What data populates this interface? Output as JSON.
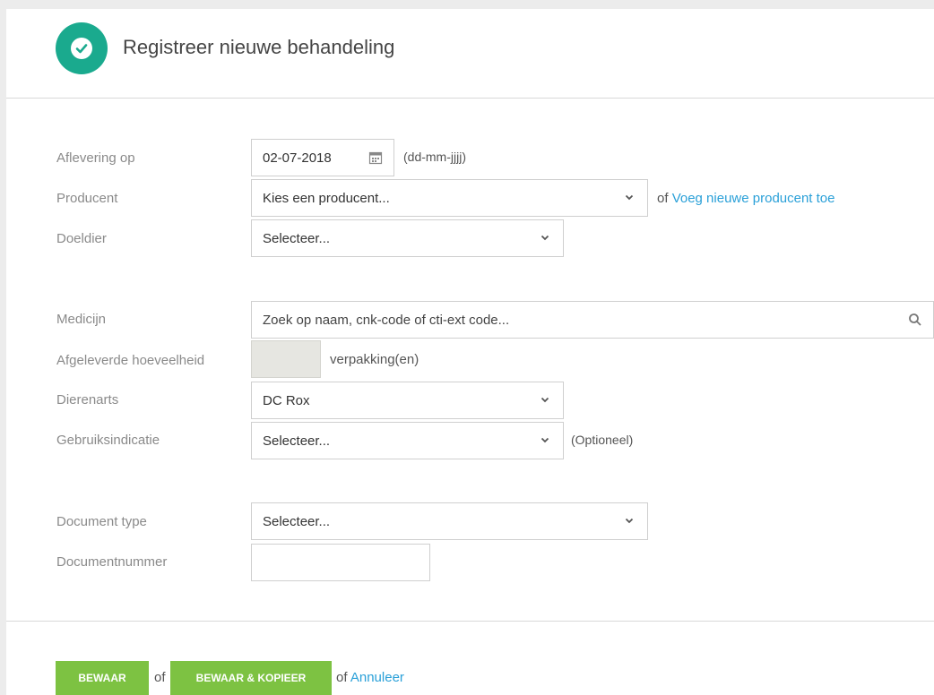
{
  "header": {
    "title": "Registreer nieuwe behandeling"
  },
  "form": {
    "aflevering": {
      "label": "Aflevering op",
      "value": "02-07-2018",
      "hint": "(dd-mm-jjjj)"
    },
    "producent": {
      "label": "Producent",
      "value": "Kies een producent...",
      "or": "of",
      "add_link": "Voeg nieuwe producent toe"
    },
    "doeldier": {
      "label": "Doeldier",
      "value": "Selecteer..."
    },
    "medicijn": {
      "label": "Medicijn",
      "placeholder": "Zoek op naam, cnk-code of cti-ext code..."
    },
    "hoeveelheid": {
      "label": "Afgeleverde hoeveelheid",
      "unit": "verpakking(en)"
    },
    "dierenarts": {
      "label": "Dierenarts",
      "value": "DC Rox"
    },
    "gebruiksindicatie": {
      "label": "Gebruiksindicatie",
      "value": "Selecteer...",
      "hint": "(Optioneel)"
    },
    "document_type": {
      "label": "Document type",
      "value": "Selecteer..."
    },
    "documentnummer": {
      "label": "Documentnummer"
    }
  },
  "actions": {
    "save": "BEWAAR",
    "or1": "of",
    "save_copy": "BEWAAR & KOPIEER",
    "or2": "of",
    "cancel": "Annuleer"
  },
  "colors": {
    "accent": "#1aaa8e",
    "button": "#7dc242",
    "link": "#2aa0d8"
  }
}
